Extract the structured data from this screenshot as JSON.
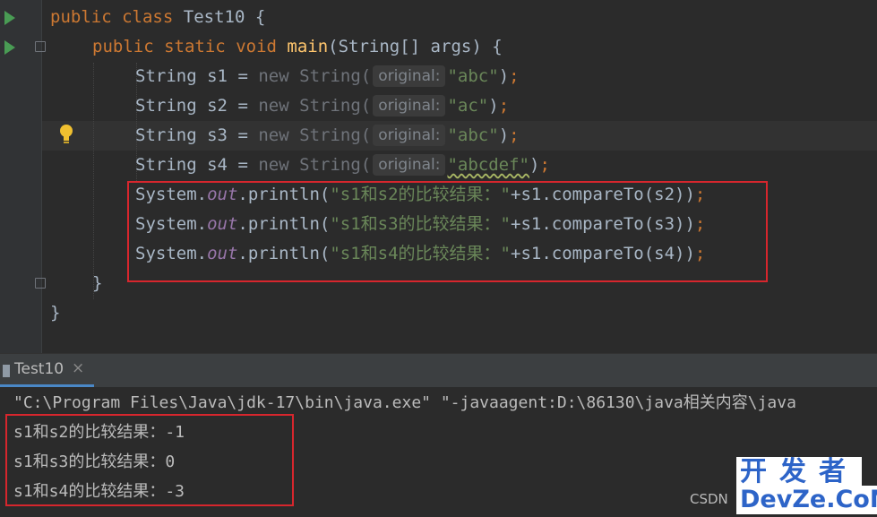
{
  "editor": {
    "class_kw1": "public",
    "class_kw2": "class",
    "class_name": "Test10",
    "brace_open": "{",
    "main_kw1": "public",
    "main_kw2": "static",
    "main_kw3": "void",
    "main_name": "main",
    "main_params": "(String[] args) {",
    "hint": "original:",
    "decls": [
      {
        "type": "String",
        "var": "s1",
        "arg": "\"abc\""
      },
      {
        "type": "String",
        "var": "s2",
        "arg": "\"ac\""
      },
      {
        "type": "String",
        "var": "s3",
        "arg": "\"abc\""
      },
      {
        "type": "String",
        "var": "s4",
        "arg": "\"abcdef\""
      }
    ],
    "eq": "=",
    "new_kw": "new",
    "ctor": "String(",
    "close_paren": ")",
    "semi": ";",
    "prints": [
      {
        "sys": "System.",
        "out": "out",
        "call": ".println(",
        "str": "\"s1和s2的比较结果：\"",
        "rest": "+s1.compareTo(s2))"
      },
      {
        "sys": "System.",
        "out": "out",
        "call": ".println(",
        "str": "\"s1和s3的比较结果：\"",
        "rest": "+s1.compareTo(s3))"
      },
      {
        "sys": "System.",
        "out": "out",
        "call": ".println(",
        "str": "\"s1和s4的比较结果：\"",
        "rest": "+s1.compareTo(s4))"
      }
    ],
    "brace_close_inner": "}",
    "brace_close_outer": "}"
  },
  "run_tab": {
    "label": "Test10",
    "close": "×"
  },
  "console": {
    "command": "\"C:\\Program Files\\Java\\jdk-17\\bin\\java.exe\" \"-javaagent:D:\\86130\\java相关内容\\java",
    "outputs": [
      "s1和s2的比较结果：-1",
      "s1和s3的比较结果：0",
      "s1和s4的比较结果：-3"
    ]
  },
  "watermark": {
    "csdn": "CSDN",
    "top": "开发者",
    "bottom": "DevZe.CoM"
  },
  "colors": {
    "highlight_box": "#d7262d",
    "keyword": "#cc7832",
    "string": "#6a8759",
    "method": "#ffc66d",
    "static_field": "#9876aa"
  }
}
